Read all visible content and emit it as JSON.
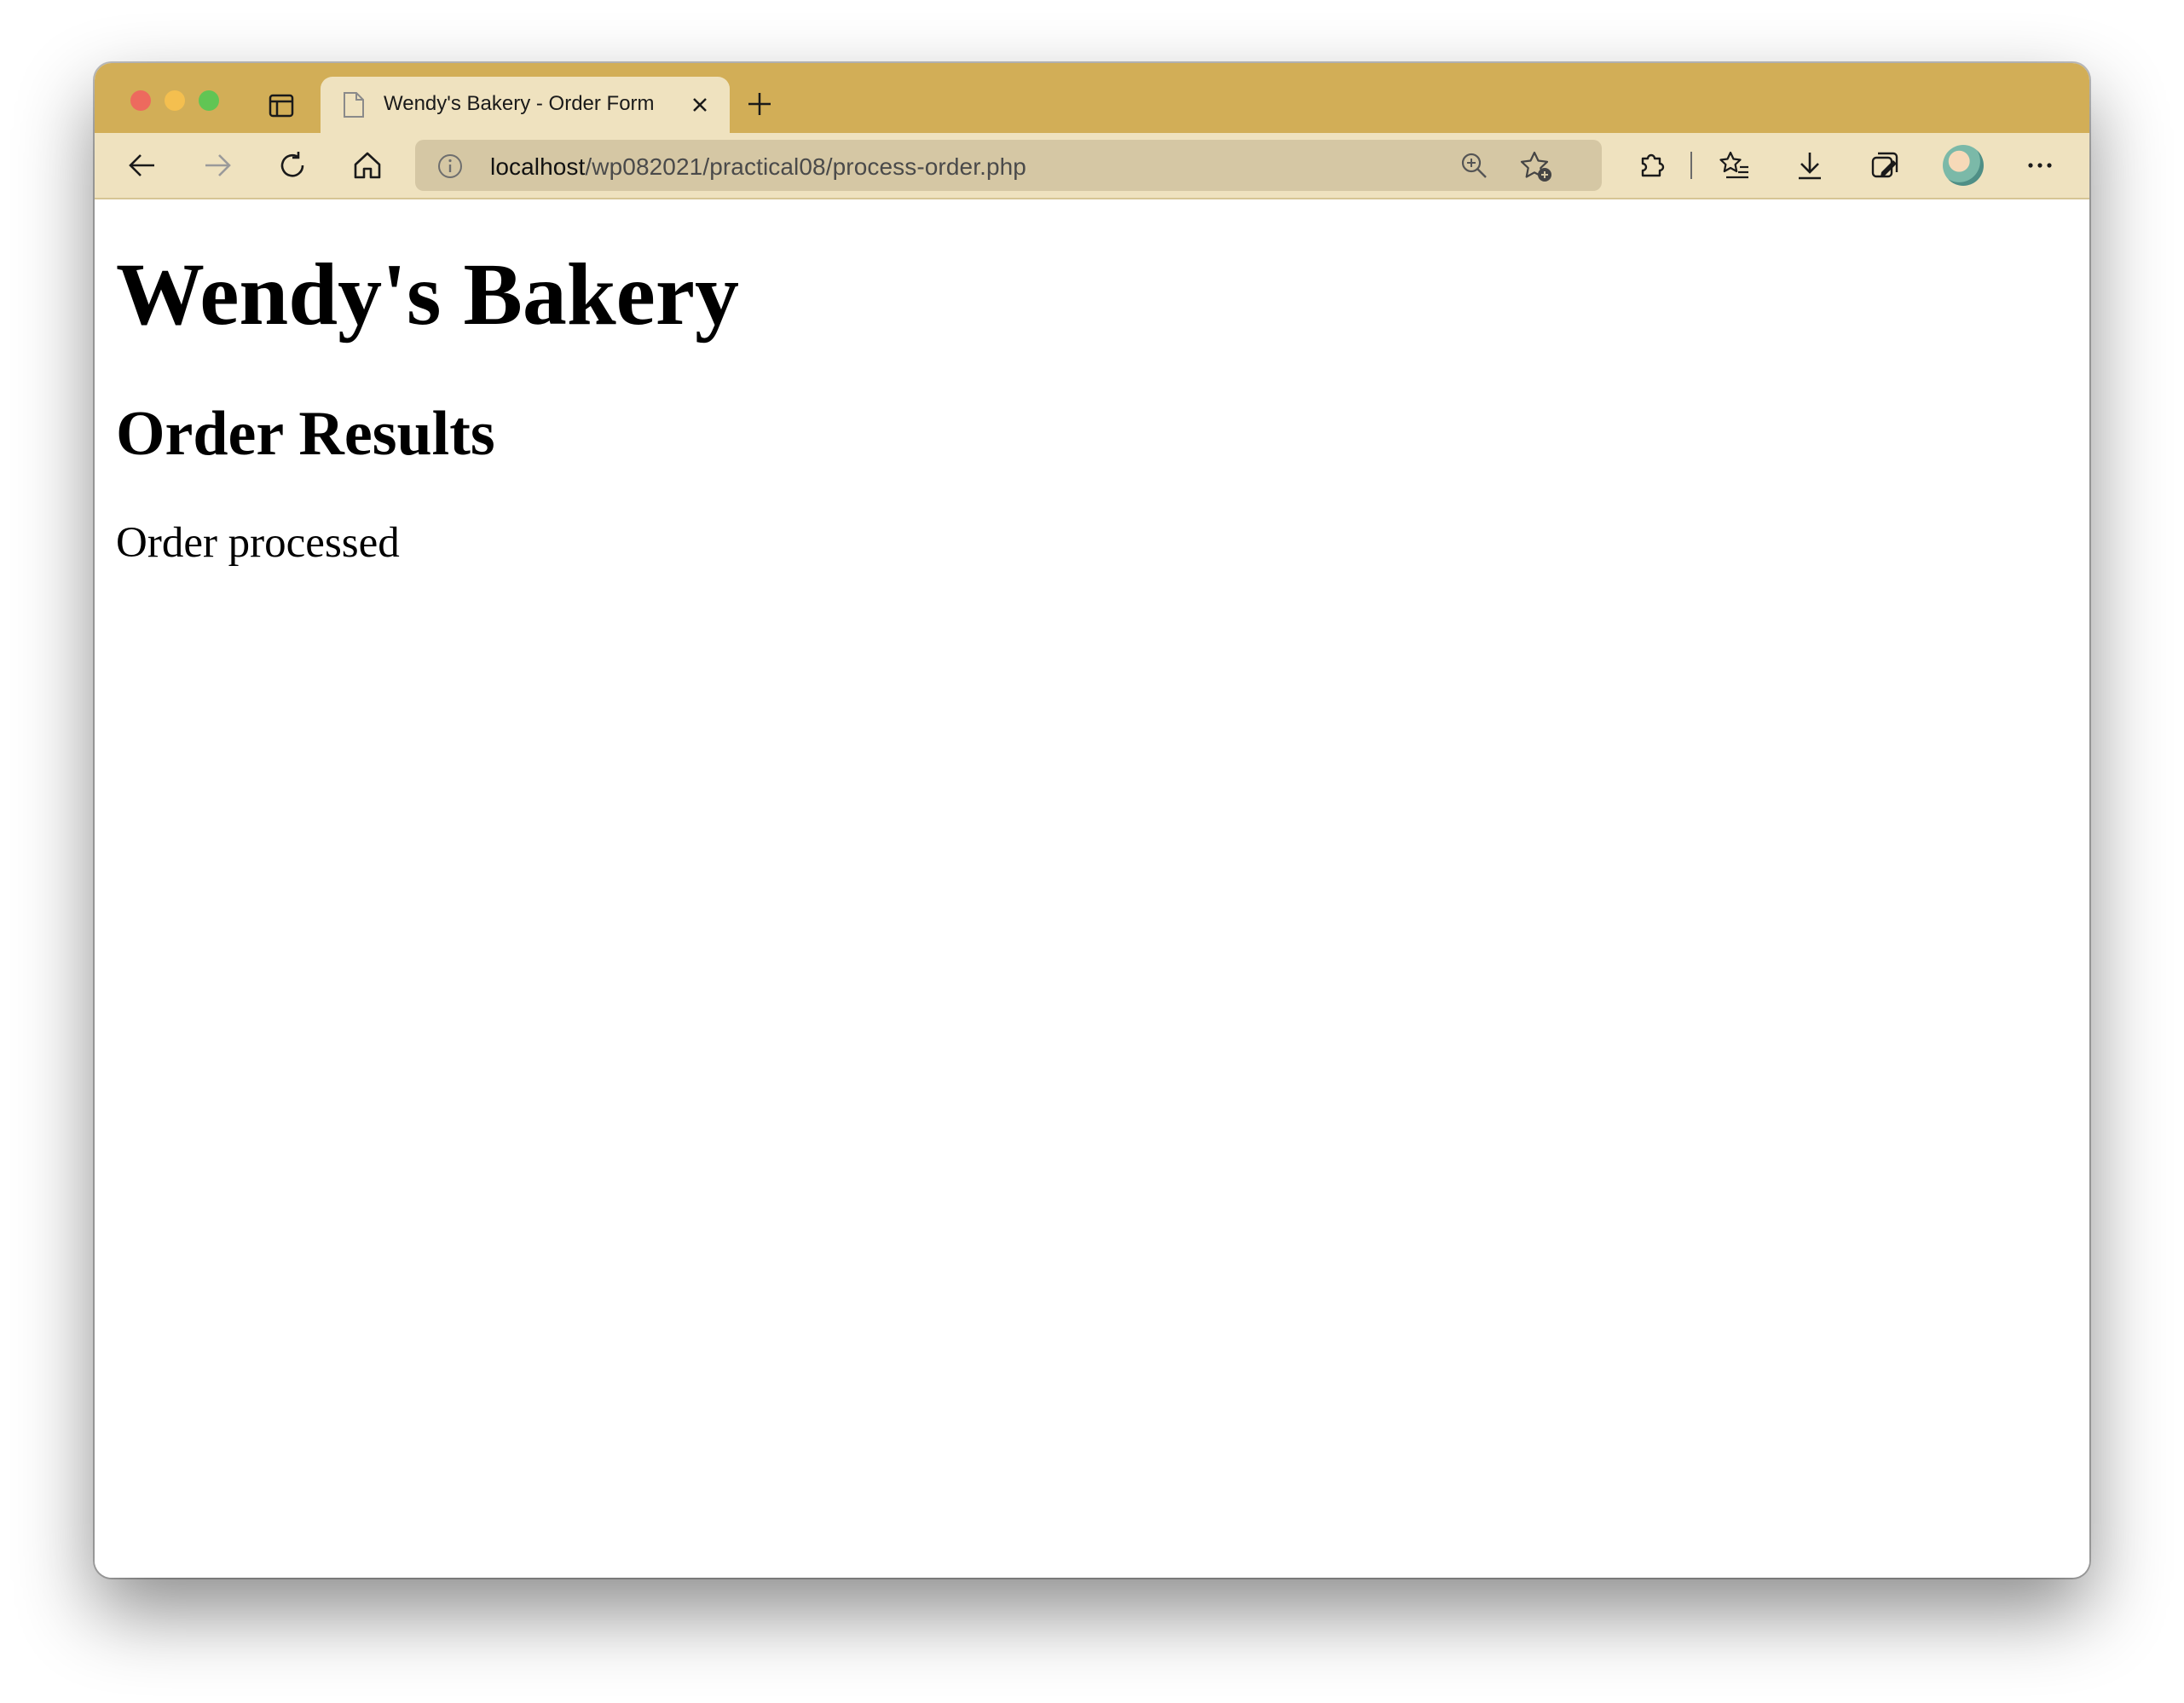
{
  "browser": {
    "tab_title": "Wendy's Bakery - Order Form",
    "url_host": "localhost",
    "url_path": "/wp082021/practical08/process-order.php"
  },
  "icons": {
    "window_controls": [
      "close-dot",
      "minimize-dot",
      "maximize-dot"
    ],
    "toolbar": [
      "back-icon",
      "forward-icon",
      "reload-icon",
      "home-icon",
      "info-icon",
      "zoom-icon",
      "add-favorite-icon",
      "extensions-icon",
      "favorites-icon",
      "downloads-icon",
      "collections-icon",
      "avatar",
      "more-icon"
    ]
  },
  "colors": {
    "tab_strip": "#d2ae57",
    "toolbar": "#efe2bf",
    "address_bar": "#d5c7a4"
  },
  "page": {
    "title": "Wendy's Bakery",
    "heading": "Order Results",
    "status": "Order processed"
  }
}
